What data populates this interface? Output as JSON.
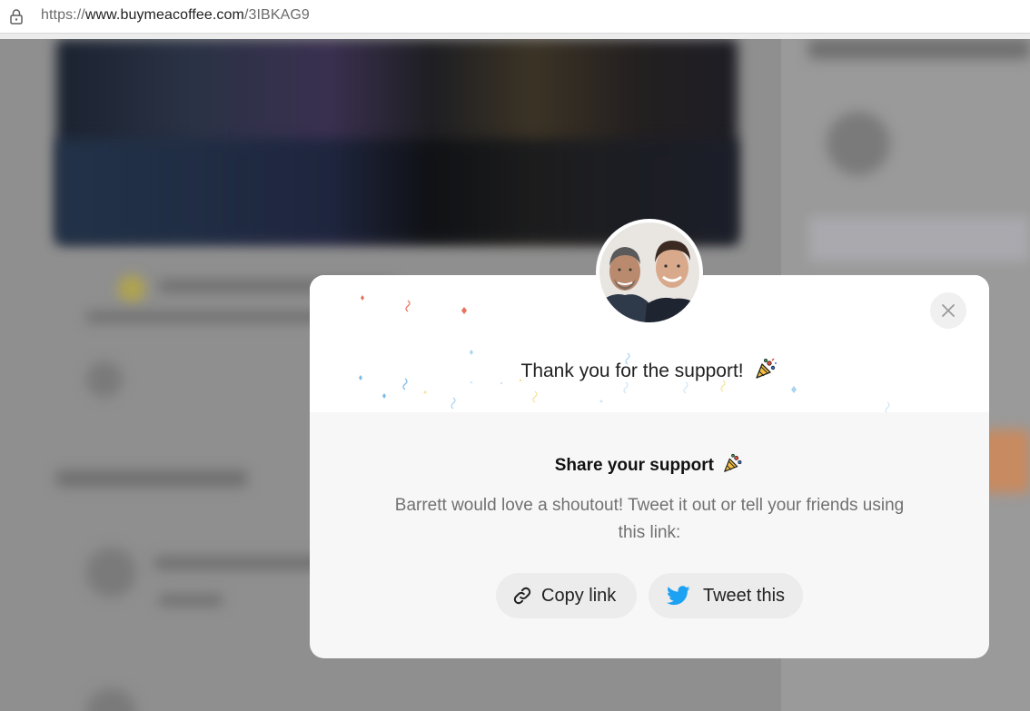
{
  "browser": {
    "url_scheme": "https://",
    "url_host": "www.buymeacoffee.com",
    "url_path": "/3IBKAG9"
  },
  "modal": {
    "thanks_text": "Thank you for the support!",
    "share_title": "Share your support",
    "share_description": "Barrett would love a shoutout! Tweet it out or tell your friends using this link:",
    "copy_link_label": "Copy link",
    "tweet_label": "Tweet this",
    "close_icon": "close-icon",
    "party_icon": "party-popper-icon",
    "link_icon": "link-icon",
    "twitter_icon": "twitter-bird-icon"
  },
  "colors": {
    "overlay": "#8d8d8d",
    "modal_bg": "#f7f7f7",
    "button_bg": "#ececec",
    "twitter_blue": "#1da1f2"
  }
}
